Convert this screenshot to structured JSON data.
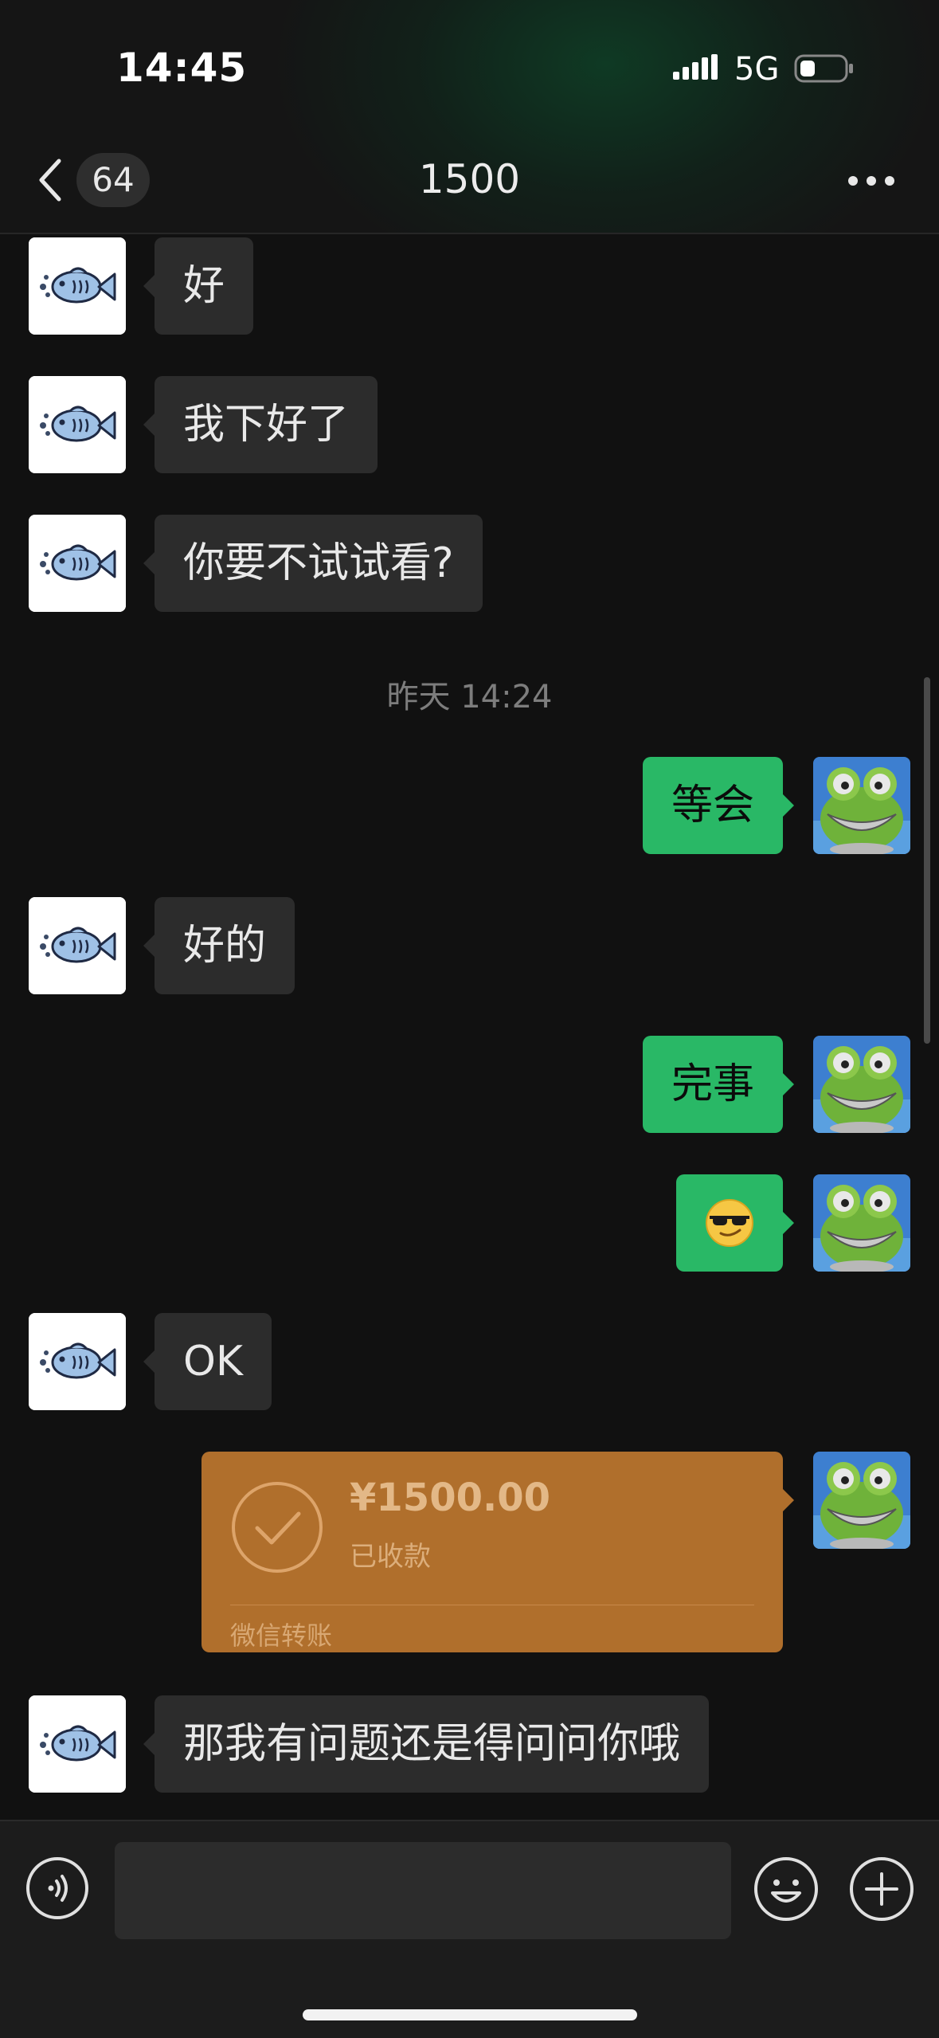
{
  "status_bar": {
    "time": "14:45",
    "network": "5G",
    "icons": [
      "signal-icon",
      "battery-icon"
    ]
  },
  "nav": {
    "back_icon": "chevron-left-icon",
    "unread_count": "64",
    "title": "1500",
    "more_icon": "more-dots-icon"
  },
  "messages": [
    {
      "type": "incoming",
      "text": "好",
      "avatar": "fish-avatar"
    },
    {
      "type": "incoming",
      "text": "我下好了",
      "avatar": "fish-avatar"
    },
    {
      "type": "incoming",
      "text": "你要不试试看?",
      "avatar": "fish-avatar"
    },
    {
      "type": "timestamp",
      "text": "昨天 14:24"
    },
    {
      "type": "outgoing",
      "text": "等会",
      "avatar": "frog-avatar"
    },
    {
      "type": "incoming",
      "text": "好的",
      "avatar": "fish-avatar"
    },
    {
      "type": "outgoing",
      "text": "完事",
      "avatar": "frog-avatar"
    },
    {
      "type": "outgoing",
      "emoji": "sunglasses-emoji",
      "text": "😎",
      "avatar": "frog-avatar"
    },
    {
      "type": "incoming",
      "text": "OK",
      "avatar": "fish-avatar"
    },
    {
      "type": "transfer",
      "amount": "¥1500.00",
      "status": "已收款",
      "footer": "微信转账",
      "icon": "check-circle-icon",
      "avatar": "frog-avatar"
    },
    {
      "type": "incoming",
      "text": "那我有问题还是得问问你哦",
      "avatar": "fish-avatar"
    }
  ],
  "input_bar": {
    "voice_icon": "voice-icon",
    "text_value": "",
    "emoji_icon": "emoji-icon",
    "plus_icon": "plus-icon"
  },
  "colors": {
    "outgoing_bubble": "#29b866",
    "incoming_bubble": "#2c2c2c",
    "transfer_card": "#b06f2c",
    "background": "#111111"
  }
}
